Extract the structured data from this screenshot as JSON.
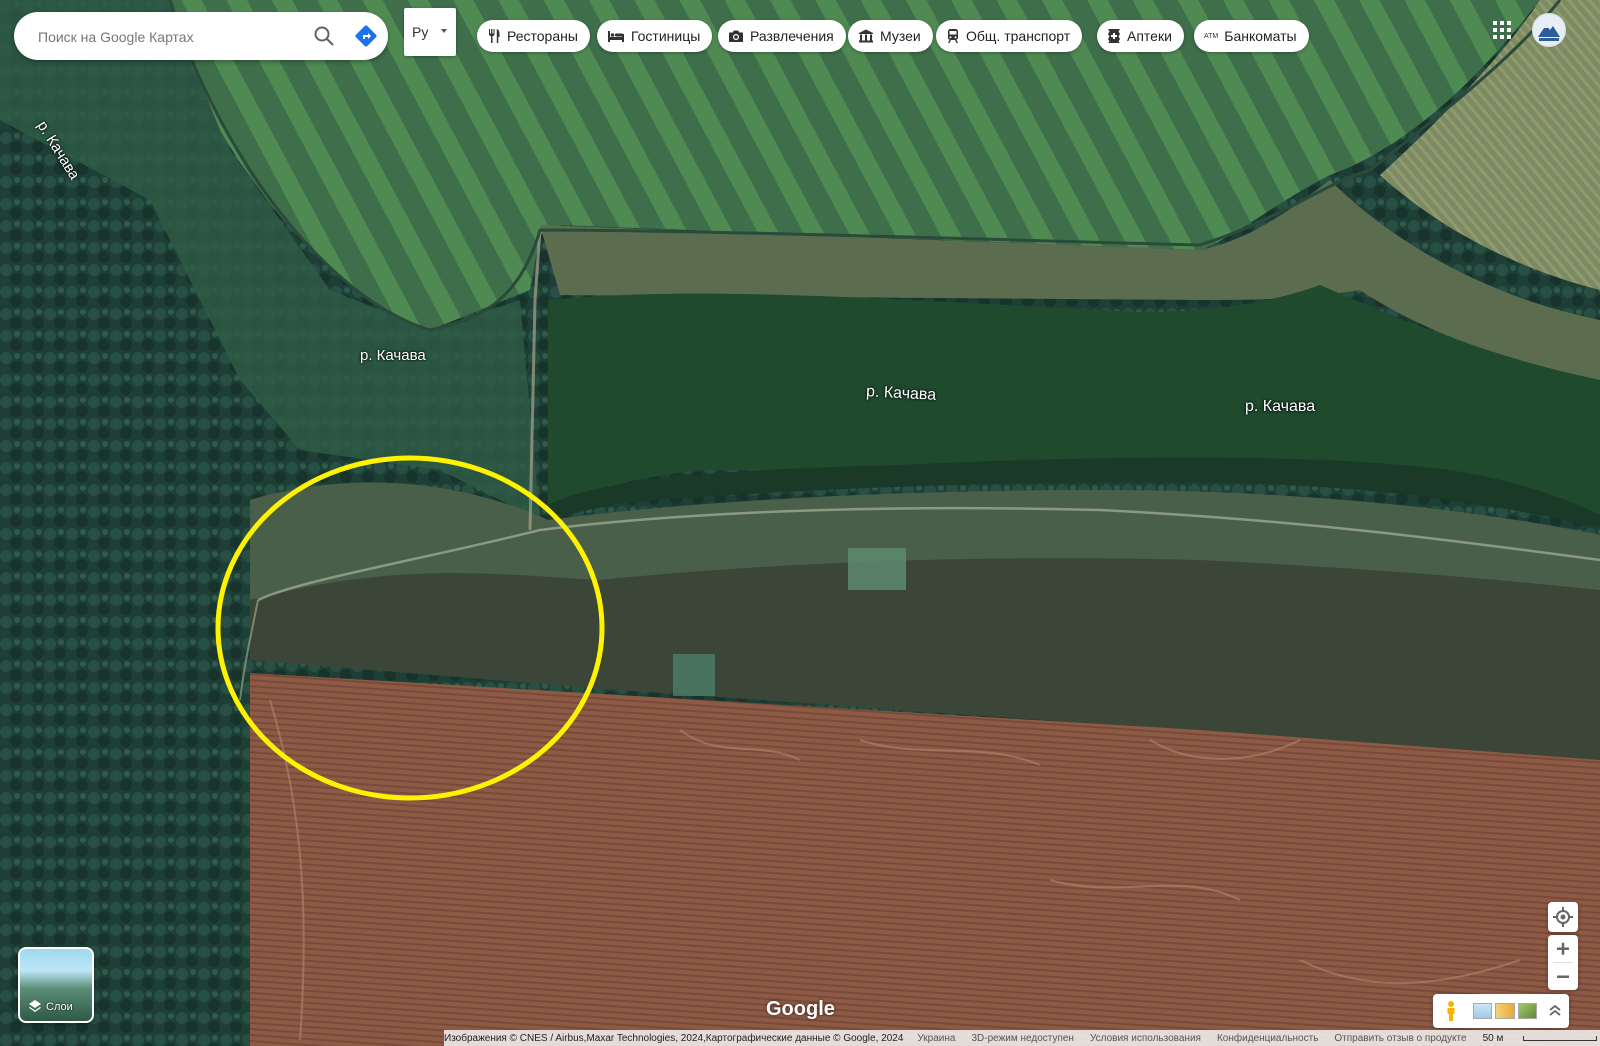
{
  "search": {
    "placeholder": "Поиск на Google Картах"
  },
  "language_selector": {
    "value": "Ру"
  },
  "category_chips": [
    {
      "label": "Рестораны",
      "icon": "fork-knife-icon"
    },
    {
      "label": "Гостиницы",
      "icon": "bed-icon"
    },
    {
      "label": "Развлечения",
      "icon": "camera-icon"
    },
    {
      "label": "Музеи",
      "icon": "museum-icon"
    },
    {
      "label": "Общ. транспорт",
      "icon": "train-icon"
    },
    {
      "label": "Аптеки",
      "icon": "pharmacy-icon"
    },
    {
      "label": "Банкоматы",
      "icon": "atm-icon",
      "icon_text": "ATM"
    }
  ],
  "map_labels": [
    {
      "name": "river-label-top-left",
      "text": "р. Качава"
    },
    {
      "name": "river-label-left",
      "text": "р. Качава"
    },
    {
      "name": "river-label-center",
      "text": "р. Качава"
    },
    {
      "name": "river-label-right",
      "text": "р. Качава"
    }
  ],
  "map": {
    "type": "satellite",
    "annotation": "yellow ellipse",
    "highlight_color": "#fff200"
  },
  "layers": {
    "label": "Слои"
  },
  "brand": {
    "logo": "Google"
  },
  "footer": {
    "imagery": "Изображения © CNES / Airbus,Maxar Technologies, 2024,Картографические данные © Google, 2024",
    "country": "Украина",
    "mode_3d": "3D-режим недоступен",
    "terms": "Условия использования",
    "privacy": "Конфиденциальность",
    "feedback": "Отправить отзыв о продукте",
    "scale": "50 м"
  },
  "colors": {
    "chip_bg": "#ffffff",
    "accent_blue": "#1a73e8",
    "field_brown": "#8a5a44",
    "water": "#1f4a2e"
  }
}
